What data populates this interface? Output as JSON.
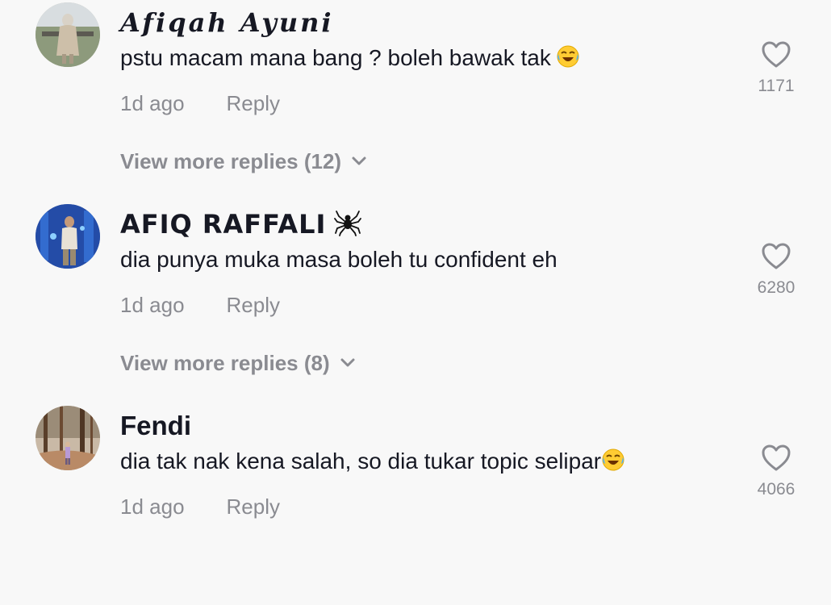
{
  "comments": [
    {
      "username": "Afiqah Ayuni",
      "text": "pstu macam mana bang ? boleh bawak tak",
      "emoji_icon": "laughing-tears-emoji",
      "time": "1d ago",
      "reply_label": "Reply",
      "likes": "1171",
      "view_more": "View more replies (12)"
    },
    {
      "username": "AFIQ RAFFALI",
      "username_icon": "spider-icon",
      "text": "dia punya muka masa boleh tu confident eh",
      "time": "1d ago",
      "reply_label": "Reply",
      "likes": "6280",
      "view_more": "View more replies (8)"
    },
    {
      "username": "Fendi",
      "text": "dia tak nak kena salah, so dia tukar topic selipar",
      "emoji_icon": "laughing-tears-emoji",
      "time": "1d ago",
      "reply_label": "Reply",
      "likes": "4066"
    }
  ],
  "colors": {
    "background": "#f8f8f8",
    "primary_text": "#161823",
    "secondary_text": "#8a8b91"
  }
}
